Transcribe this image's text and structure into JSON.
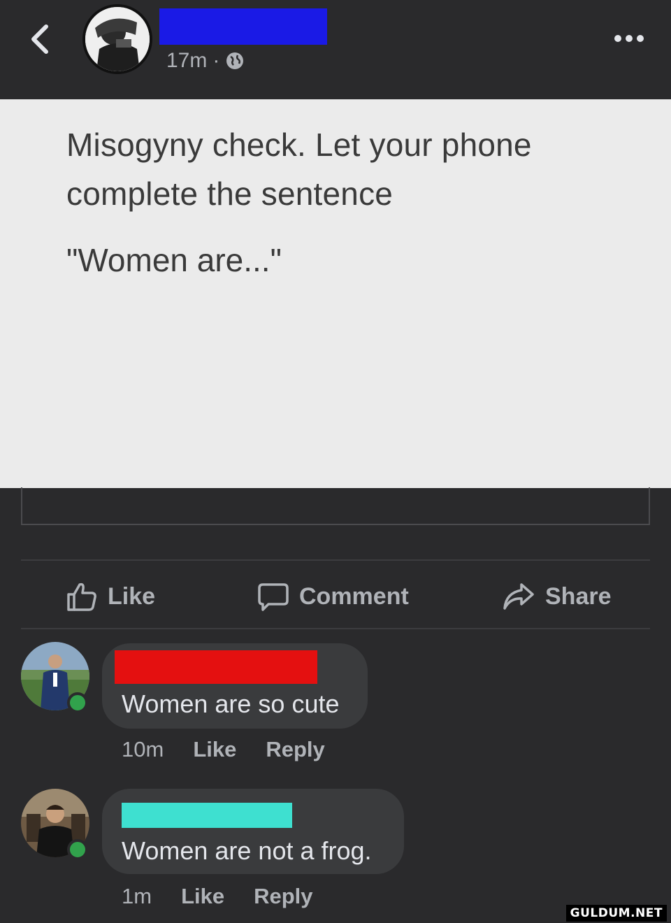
{
  "header": {
    "timestamp": "17m",
    "separator": "·",
    "back_icon": "chevron-left-icon",
    "privacy_icon": "globe-icon",
    "more_icon": "more-horizontal-icon",
    "name_redaction_color": "#1a1ae6"
  },
  "post": {
    "text": "Misogyny check. Let your phone complete the sentence",
    "quote": "\"Women are...\""
  },
  "actions": {
    "like": "Like",
    "comment": "Comment",
    "share": "Share"
  },
  "comments": [
    {
      "name_redaction_color": "#e41010",
      "text": "Women are so cute",
      "time": "10m",
      "like": "Like",
      "reply": "Reply"
    },
    {
      "name_redaction_color": "#3ee0d0",
      "text": "Women are not a frog.",
      "time": "1m",
      "like": "Like",
      "reply": "Reply"
    }
  ],
  "watermark": "GULDUM.NET",
  "colors": {
    "background": "#2a2a2c",
    "card": "#ebebeb",
    "online": "#31a24c"
  }
}
